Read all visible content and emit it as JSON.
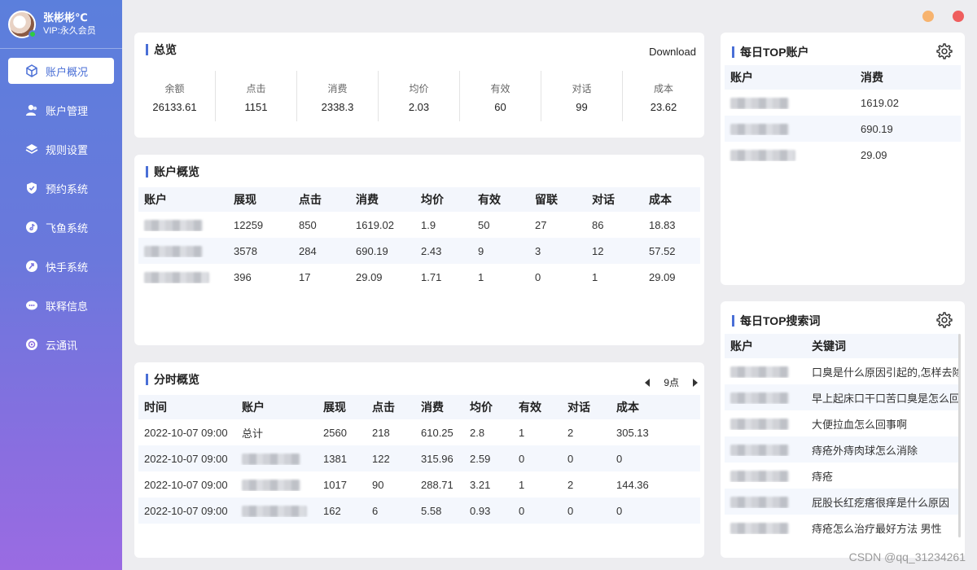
{
  "profile": {
    "name": "张彬彬℃",
    "vip": "VIP:永久会员"
  },
  "nav": [
    {
      "label": "账户概况",
      "icon": "cube-icon",
      "active": true
    },
    {
      "label": "账户管理",
      "icon": "users-icon"
    },
    {
      "label": "规则设置",
      "icon": "layers-icon"
    },
    {
      "label": "预约系统",
      "icon": "shield-icon"
    },
    {
      "label": "飞鱼系统",
      "icon": "tiktok-icon"
    },
    {
      "label": "快手系统",
      "icon": "kuaishou-icon"
    },
    {
      "label": "联释信息",
      "icon": "chat-icon"
    },
    {
      "label": "云通讯",
      "icon": "cloud-icon"
    }
  ],
  "overview": {
    "title": "总览",
    "download": "Download",
    "stats": [
      {
        "label": "余额",
        "value": "26133.61"
      },
      {
        "label": "点击",
        "value": "1151"
      },
      {
        "label": "消费",
        "value": "2338.3"
      },
      {
        "label": "均价",
        "value": "2.03"
      },
      {
        "label": "有效",
        "value": "60"
      },
      {
        "label": "对话",
        "value": "99"
      },
      {
        "label": "成本",
        "value": "23.62"
      }
    ]
  },
  "account_overview": {
    "title": "账户概览",
    "headers": [
      "账户",
      "展现",
      "点击",
      "消费",
      "均价",
      "有效",
      "留联",
      "对话",
      "成本"
    ],
    "rows": [
      [
        "",
        "12259",
        "850",
        "1619.02",
        "1.9",
        "50",
        "27",
        "86",
        "18.83"
      ],
      [
        "",
        "3578",
        "284",
        "690.19",
        "2.43",
        "9",
        "3",
        "12",
        "57.52"
      ],
      [
        "",
        "396",
        "17",
        "29.09",
        "1.71",
        "1",
        "0",
        "1",
        "29.09"
      ]
    ]
  },
  "hourly": {
    "title": "分时概览",
    "page": "9点",
    "headers": [
      "时间",
      "账户",
      "展现",
      "点击",
      "消费",
      "均价",
      "有效",
      "对话",
      "成本"
    ],
    "rows": [
      [
        "2022-10-07 09:00",
        "总计",
        "2560",
        "218",
        "610.25",
        "2.8",
        "1",
        "2",
        "305.13"
      ],
      [
        "2022-10-07 09:00",
        "",
        "1381",
        "122",
        "315.96",
        "2.59",
        "0",
        "0",
        "0"
      ],
      [
        "2022-10-07 09:00",
        "",
        "1017",
        "90",
        "288.71",
        "3.21",
        "1",
        "2",
        "144.36"
      ],
      [
        "2022-10-07 09:00",
        "",
        "162",
        "6",
        "5.58",
        "0.93",
        "0",
        "0",
        "0"
      ]
    ]
  },
  "top_accounts": {
    "title": "每日TOP账户",
    "headers": [
      "账户",
      "消费"
    ],
    "rows": [
      [
        "",
        "1619.02"
      ],
      [
        "",
        "690.19"
      ],
      [
        "",
        "29.09"
      ]
    ]
  },
  "top_keywords": {
    "title": "每日TOP搜索词",
    "headers": [
      "账户",
      "关键词"
    ],
    "rows": [
      [
        "",
        "口臭是什么原因引起的,怎样去除"
      ],
      [
        "",
        "早上起床口干口苦口臭是怎么回事"
      ],
      [
        "",
        "大便拉血怎么回事啊"
      ],
      [
        "",
        "痔疮外痔肉球怎么消除"
      ],
      [
        "",
        "痔疮"
      ],
      [
        "",
        "屁股长红疙瘩很痒是什么原因"
      ],
      [
        "",
        "痔疮怎么治疗最好方法 男性"
      ]
    ]
  },
  "watermark": "CSDN @qq_31234261",
  "colors": {
    "accent": "#4a6fd6",
    "sidebar_top": "#5b7fdc",
    "sidebar_bottom": "#9a6be2",
    "close": "#ef5e5e",
    "minimize": "#f7b36e"
  }
}
